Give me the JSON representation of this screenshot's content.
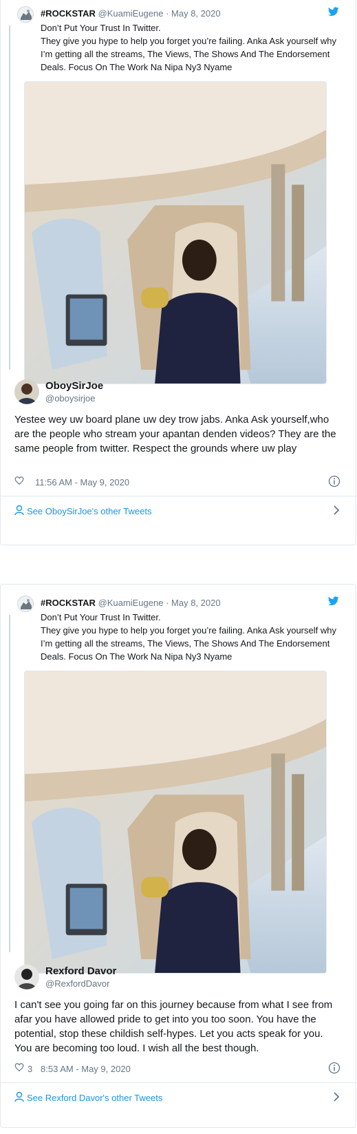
{
  "cards": [
    {
      "quoted": {
        "name": "#ROCKSTAR",
        "handle": "@KuamiEugene",
        "date": "May 8, 2020",
        "text_line1": "Don’t Put Your Trust In Twitter.",
        "text_line2": "They give you hype to help you forget you’re failing. Anka Ask yourself why I’m getting all the streams, The Views, The Shows And The Endorsement Deals. Focus On The Work Na Nipa Ny3 Nyame"
      },
      "author": {
        "name": "OboySirJoe",
        "handle": "@oboysirjoe"
      },
      "text": "Yestee wey uw board plane uw dey trow jabs. Anka Ask yourself,who are the people who stream your apantan denden videos? They are the same people from twitter. Respect the grounds where uw play",
      "likes": "",
      "time": "11:56 AM - May 9, 2020",
      "see_other": "See OboySirJoe's other Tweets"
    },
    {
      "quoted": {
        "name": "#ROCKSTAR",
        "handle": "@KuamiEugene",
        "date": "May 8, 2020",
        "text_line1": "Don’t Put Your Trust In Twitter.",
        "text_line2": "They give you hype to help you forget you’re failing. Anka Ask yourself why I’m getting all the streams, The Views, The Shows And The Endorsement Deals. Focus On The Work Na Nipa Ny3 Nyame"
      },
      "author": {
        "name": "Rexford Davor",
        "handle": "@RexfordDavor"
      },
      "text": "I can't see you going far on this journey because from what I see from afar you have allowed pride to get into you too soon. You have the potential, stop these childish self-hypes. Let you acts speak for you. You are becoming too loud. I wish all the best though.",
      "likes": "3",
      "time": "8:53 AM - May 9, 2020",
      "see_other": "See Rexford Davor's other Tweets"
    }
  ],
  "colors": {
    "twitter_blue": "#1da1f2",
    "link_blue": "#1b95e0",
    "secondary_text": "#657786",
    "border": "#e1e8ed"
  },
  "icons": [
    "twitter-bird-icon",
    "heart-icon",
    "info-icon",
    "user-icon",
    "chevron-right-icon"
  ]
}
